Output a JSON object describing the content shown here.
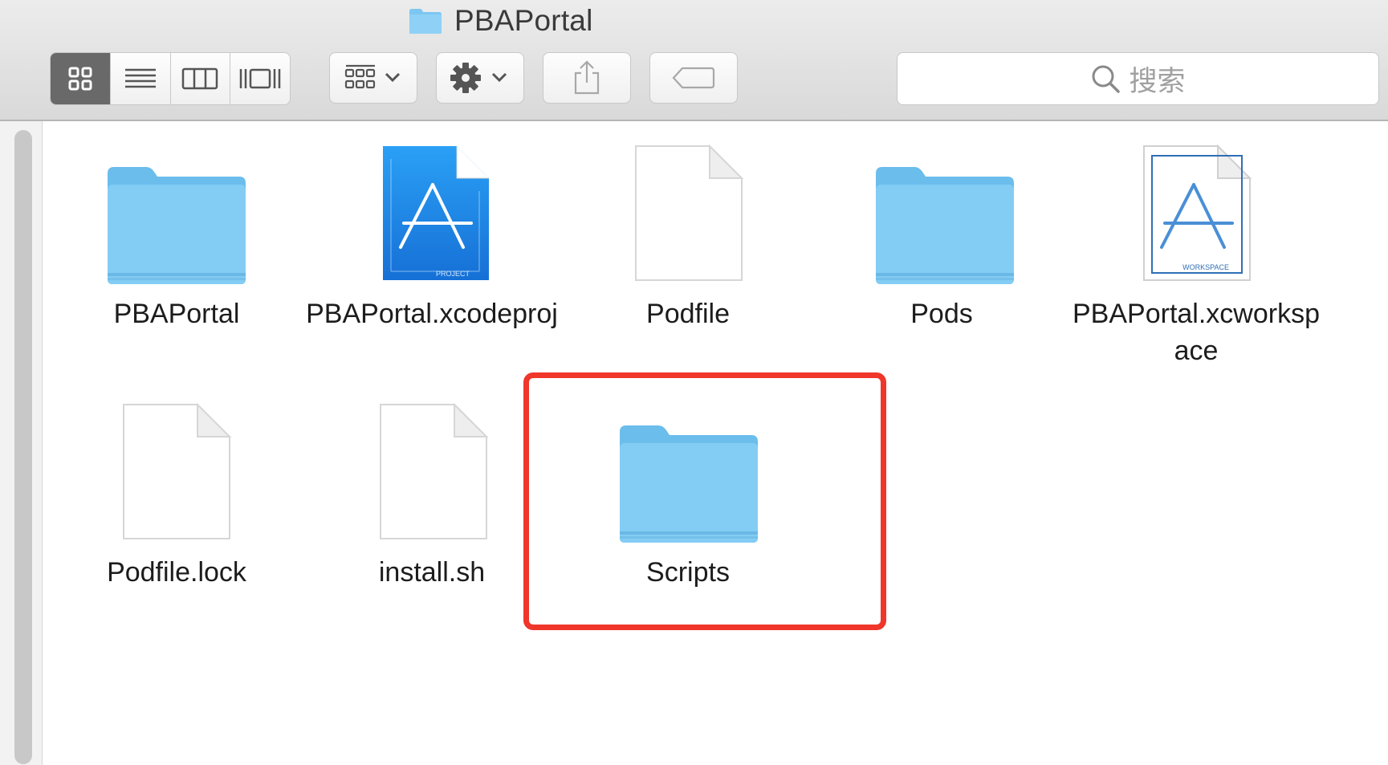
{
  "window": {
    "title": "PBAPortal"
  },
  "toolbar": {
    "view_modes": [
      "icon-view",
      "list-view",
      "column-view",
      "cover-flow-view"
    ],
    "active_view": "icon-view",
    "search_placeholder": "搜索"
  },
  "files": [
    {
      "name": "PBAPortal",
      "type": "folder"
    },
    {
      "name": "PBAPortal.xcodeproj",
      "type": "xcodeproj",
      "badge": "PROJECT"
    },
    {
      "name": "Podfile",
      "type": "document"
    },
    {
      "name": "Pods",
      "type": "folder"
    },
    {
      "name": "PBAPortal.xcworkspace",
      "type": "xcworkspace",
      "badge": "WORKSPACE"
    },
    {
      "name": "Podfile.lock",
      "type": "document"
    },
    {
      "name": "install.sh",
      "type": "document"
    },
    {
      "name": "Scripts",
      "type": "folder",
      "highlighted": true
    }
  ],
  "colors": {
    "folder": "#7cc6f2",
    "highlight": "#f0362a",
    "xcode_blue": "#1a82e2"
  }
}
